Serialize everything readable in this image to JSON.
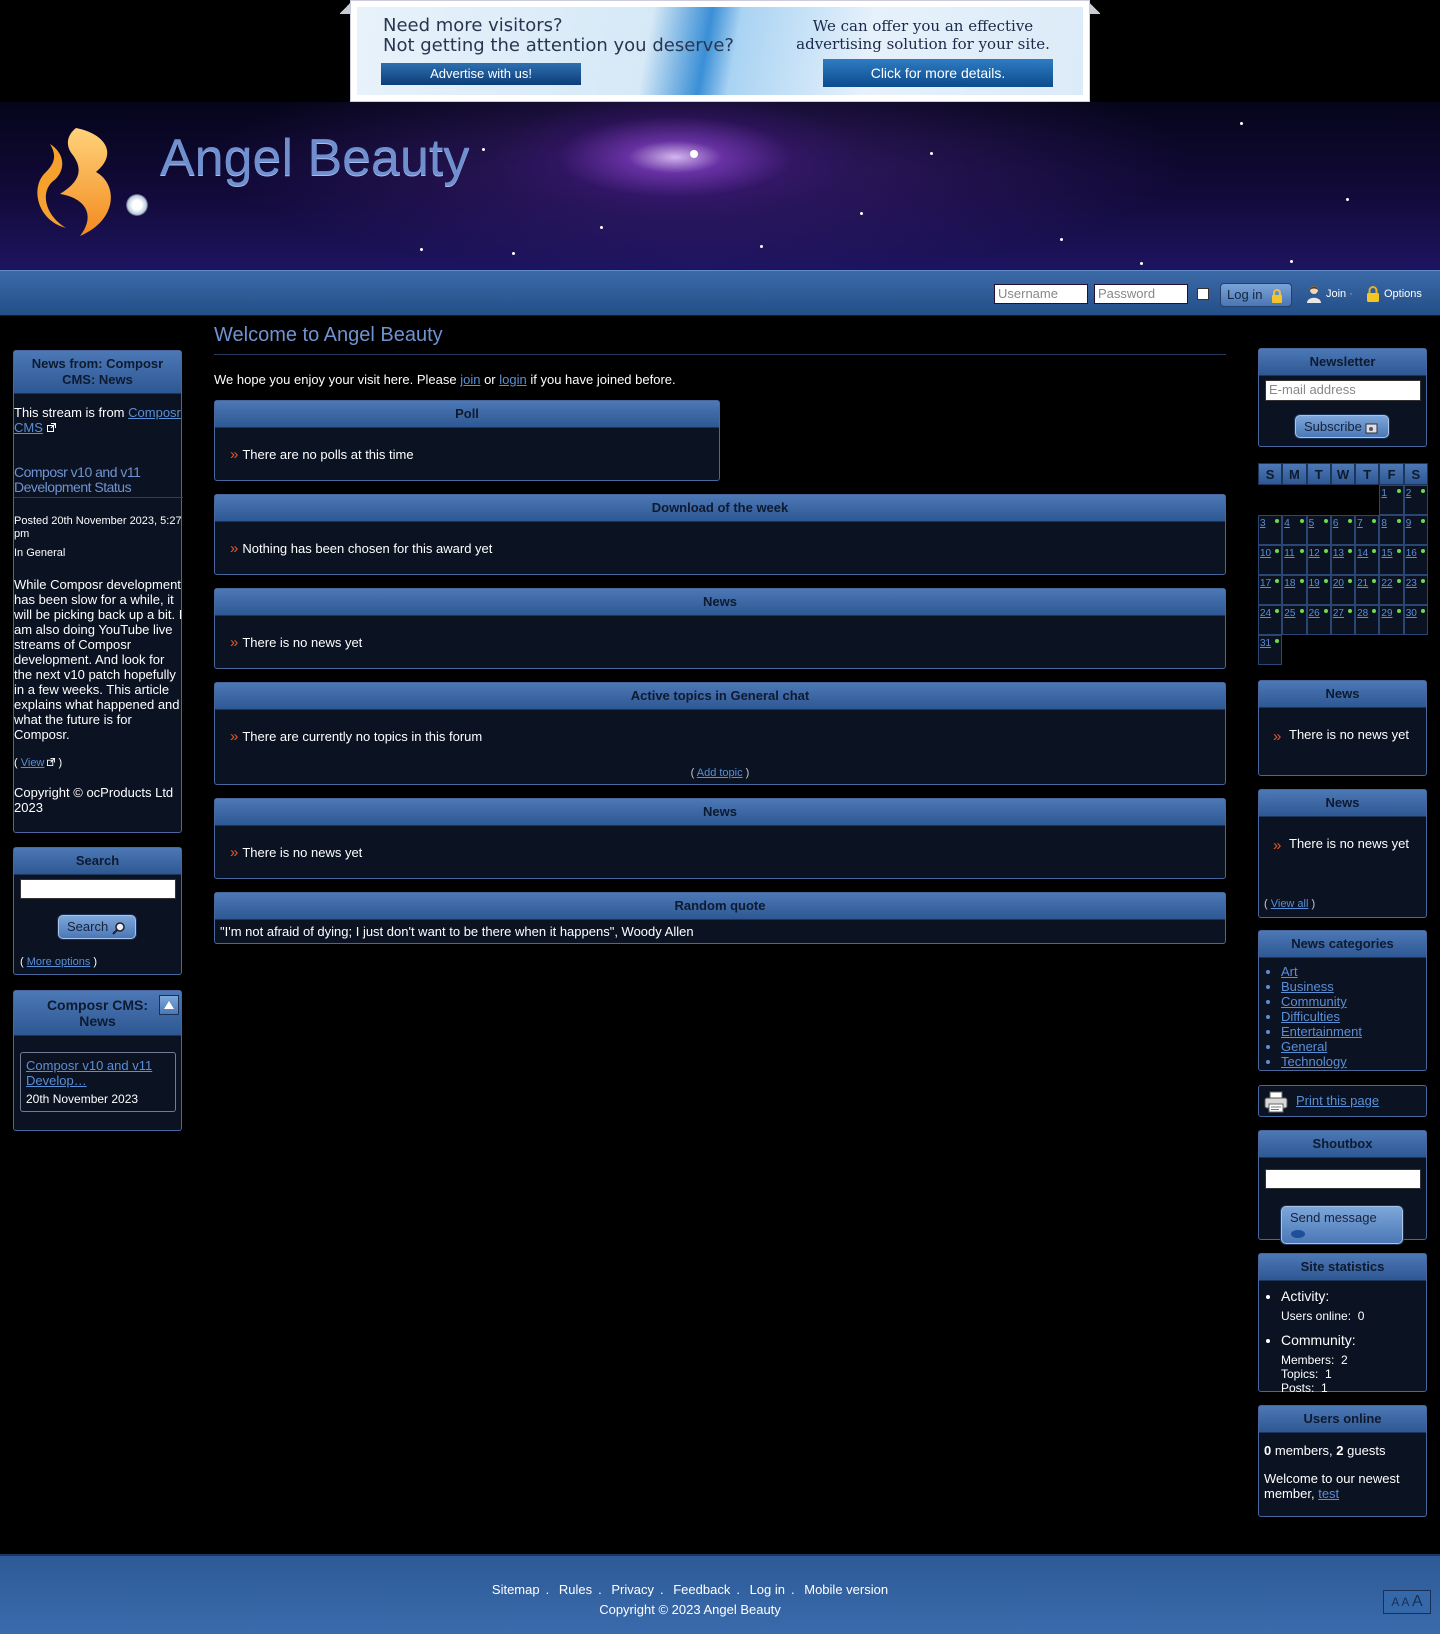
{
  "ad": {
    "line1": "Need more visitors?",
    "line2": "Not getting the attention you deserve?",
    "button1": "Advertise with us!",
    "right_line1": "We can offer you an effective",
    "right_line2": "advertising solution for your site.",
    "button2": "Click for more details."
  },
  "site": {
    "title": "Angel Beauty"
  },
  "login": {
    "username_placeholder": "Username",
    "password_placeholder": "Password",
    "login_label": "Log in",
    "join_label": "Join",
    "options_label": "Options"
  },
  "left": {
    "news_stream": {
      "title": "News from: Composr CMS: News",
      "source_prefix": "This stream is from",
      "source_link": "Composr CMS",
      "article_title": "Composr v10 and v11 Development Status",
      "posted": "Posted 20th November 2023, 5:27 pm",
      "category": "In General",
      "body": "While Composr development has been slow for a while, it will be picking back up a bit. I am also doing YouTube live streams of Composr development. And look for the next v10 patch hopefully in a few weeks. This article explains what happened and what the future is for Composr.",
      "view_label": "View",
      "copyright": "Copyright © ocProducts Ltd 2023"
    },
    "search": {
      "title": "Search",
      "button": "Search",
      "more_options": "More options"
    },
    "feed": {
      "title": "Composr CMS: News",
      "item_link": "Composr v10 and v11 Develop…",
      "item_date": "20th November 2023"
    }
  },
  "main": {
    "title": "Welcome to Angel Beauty",
    "intro_before": "We hope you enjoy your visit here. Please",
    "intro_join": "join",
    "intro_or": "or",
    "intro_login": "login",
    "intro_after": "if you have joined before.",
    "poll": {
      "title": "Poll",
      "text": "There are no polls at this time"
    },
    "download": {
      "title": "Download of the week",
      "text": "Nothing has been chosen for this award yet"
    },
    "news1": {
      "title": "News",
      "text": "There is no news yet"
    },
    "forum": {
      "title": "Active topics in General chat",
      "text": "There are currently no topics in this forum",
      "add_topic": "Add topic"
    },
    "news2": {
      "title": "News",
      "text": "There is no news yet"
    },
    "quote": {
      "title": "Random quote",
      "text": "\"I'm not afraid of dying; I just don't want to be there when it happens\", Woody Allen"
    }
  },
  "right": {
    "newsletter": {
      "title": "Newsletter",
      "placeholder": "E-mail address",
      "button": "Subscribe"
    },
    "calendar": {
      "headers": [
        "S",
        "M",
        "T",
        "W",
        "T",
        "F",
        "S"
      ],
      "weeks": [
        [
          "",
          "",
          "",
          "",
          "",
          "1",
          "2"
        ],
        [
          "3",
          "4",
          "5",
          "6",
          "7",
          "8",
          "9"
        ],
        [
          "10",
          "11",
          "12",
          "13",
          "14",
          "15",
          "16"
        ],
        [
          "17",
          "18",
          "19",
          "20",
          "21",
          "22",
          "23"
        ],
        [
          "24",
          "25",
          "26",
          "27",
          "28",
          "29",
          "30"
        ],
        [
          "31",
          "",
          "",
          "",
          "",
          "",
          ""
        ]
      ]
    },
    "news1": {
      "title": "News",
      "text": "There is no news yet"
    },
    "news2": {
      "title": "News",
      "text": "There is no news yet",
      "view_all": "View all"
    },
    "categories": {
      "title": "News categories",
      "items": [
        "Art",
        "Business",
        "Community",
        "Difficulties",
        "Entertainment",
        "General",
        "Technology"
      ]
    },
    "print": {
      "label": "Print this page"
    },
    "shoutbox": {
      "title": "Shoutbox",
      "button": "Send message"
    },
    "stats": {
      "title": "Site statistics",
      "activity": "Activity:",
      "users_online": "Users online:  0",
      "community": "Community:",
      "members": "Members:  2",
      "topics": "Topics:  1",
      "posts": "Posts:  1"
    },
    "online": {
      "title": "Users online",
      "members_count": "0",
      "members_label": "members,",
      "guests_count": "2",
      "guests_label": "guests",
      "welcome": "Welcome to our newest member,",
      "newest": "test"
    }
  },
  "footer": {
    "links": [
      "Sitemap",
      "Rules",
      "Privacy",
      "Feedback",
      "Log in",
      "Mobile version"
    ],
    "copyright": "Copyright © 2023 Angel Beauty"
  },
  "colors": {
    "background": "#000000",
    "panel_header": "#3b66a4",
    "link": "#5a8fd6",
    "bullet": "#e35a2a",
    "title": "#6f93d1"
  }
}
